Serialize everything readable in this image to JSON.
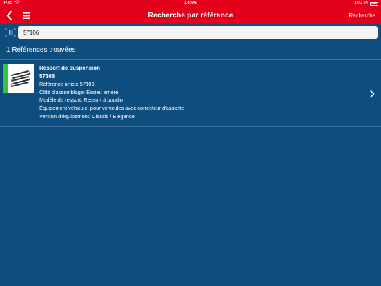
{
  "status_bar": {
    "device": "iPad",
    "time": "14:06",
    "battery": "100 %"
  },
  "navbar": {
    "title": "Recherche par référence",
    "action_label": "Recherche"
  },
  "search": {
    "value": "57106"
  },
  "results": {
    "count_label": "1 Références trouvées",
    "items": [
      {
        "title": "Ressort de suspension",
        "number": "57106",
        "details": [
          "Référence article 57106",
          "Côté d'assemblage: Essieu arrière",
          "Modèle de ressort: Ressort à boudin",
          "Équipement véhicule: pour véhicules avec correcteur d'assiette",
          "Version d'équipement: Classic / Elegance"
        ]
      }
    ]
  },
  "colors": {
    "brand_red": "#e3001b",
    "background_blue": "#0e4e7e",
    "accent_green": "#35c341"
  }
}
